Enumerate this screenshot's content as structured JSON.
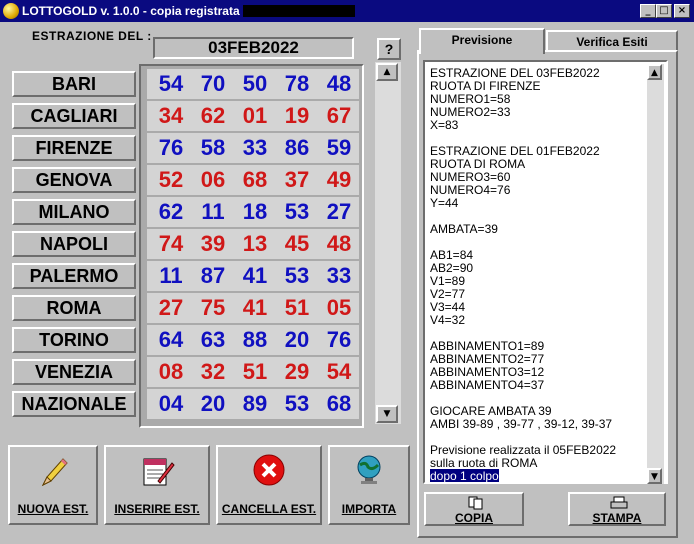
{
  "window": {
    "title": "LOTTOGOLD v. 1.0.0 - copia registrata a",
    "minimize": "_",
    "maximize": "□",
    "close": "×"
  },
  "extraction": {
    "label": "ESTRAZIONE DEL :",
    "date": "03FEB2022",
    "help_label": "?"
  },
  "wheels": [
    {
      "name": "BARI",
      "numbers": [
        "54",
        "70",
        "50",
        "78",
        "48"
      ],
      "color": "#1010c0"
    },
    {
      "name": "CAGLIARI",
      "numbers": [
        "34",
        "62",
        "01",
        "19",
        "67"
      ],
      "color": "#d01818"
    },
    {
      "name": "FIRENZE",
      "numbers": [
        "76",
        "58",
        "33",
        "86",
        "59"
      ],
      "color": "#1010c0"
    },
    {
      "name": "GENOVA",
      "numbers": [
        "52",
        "06",
        "68",
        "37",
        "49"
      ],
      "color": "#d01818"
    },
    {
      "name": "MILANO",
      "numbers": [
        "62",
        "11",
        "18",
        "53",
        "27"
      ],
      "color": "#1010c0"
    },
    {
      "name": "NAPOLI",
      "numbers": [
        "74",
        "39",
        "13",
        "45",
        "48"
      ],
      "color": "#d01818"
    },
    {
      "name": "PALERMO",
      "numbers": [
        "11",
        "87",
        "41",
        "53",
        "33"
      ],
      "color": "#1010c0"
    },
    {
      "name": "ROMA",
      "numbers": [
        "27",
        "75",
        "41",
        "51",
        "05"
      ],
      "color": "#d01818"
    },
    {
      "name": "TORINO",
      "numbers": [
        "64",
        "63",
        "88",
        "20",
        "76"
      ],
      "color": "#1010c0"
    },
    {
      "name": "VENEZIA",
      "numbers": [
        "08",
        "32",
        "51",
        "29",
        "54"
      ],
      "color": "#d01818"
    },
    {
      "name": "NAZIONALE",
      "numbers": [
        "04",
        "20",
        "89",
        "53",
        "68"
      ],
      "color": "#1010c0"
    }
  ],
  "actions": {
    "new_est": "NUOVA EST.",
    "insert_est": "INSERIRE EST.",
    "delete_est": "CANCELLA EST.",
    "import": "IMPORTA"
  },
  "tabs": {
    "prevision": "Previsione",
    "verify": "Verifica Esiti"
  },
  "prevision_text": "ESTRAZIONE DEL 03FEB2022\nRUOTA DI FIRENZE\nNUMERO1=58\nNUMERO2=33\nX=83\n\nESTRAZIONE DEL 01FEB2022\nRUOTA DI ROMA\nNUMERO3=60\nNUMERO4=76\nY=44\n\nAMBATA=39\n\nAB1=84\nAB2=90\nV1=89\nV2=77\nV3=44\nV4=32\n\nABBINAMENTO1=89\nABBINAMENTO2=77\nABBINAMENTO3=12\nABBINAMENTO4=37\n\nGIOCARE AMBATA 39\nAMBI 39-89 , 39-77 , 39-12, 39-37\n\nPrevisione realizzata il 05FEB2022\nsulla ruota di ROMA\n",
  "prevision_selected": "dopo 1 colpo",
  "bottom": {
    "copy": "COPIA",
    "print": "STAMPA"
  },
  "icons": {
    "app": "lottogold-ball-icon",
    "new": "pencil-icon",
    "insert": "notepad-pencil-icon",
    "delete": "red-x-circle-icon",
    "import": "globe-monitor-icon",
    "copy": "copy-documents-icon",
    "print": "printer-icon"
  }
}
